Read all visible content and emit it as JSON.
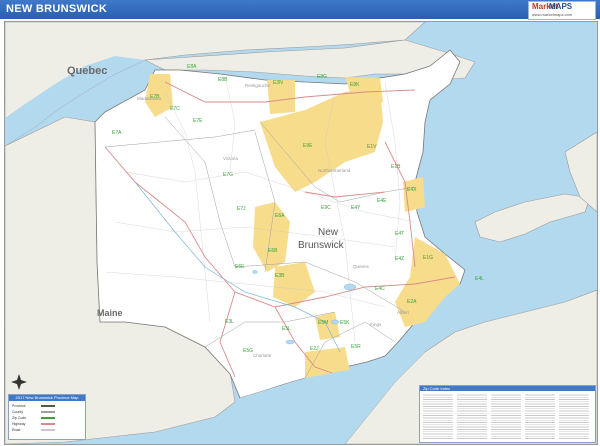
{
  "page": {
    "title": "NEW BRUNSWICK"
  },
  "logo": {
    "part1": "Market",
    "part2": "MAPS",
    "tagline": "www.marketmaps.com"
  },
  "colors": {
    "water": "#b3d9ef",
    "land_other": "#efeee6",
    "province": "#ffffff",
    "highlight": "#f7dc8c",
    "zip_label": "#3aa33a",
    "road_major": "#d98b8b",
    "boundary": "#8e8e8e",
    "title_bar": "#3f79c9"
  },
  "map": {
    "region_labels": {
      "quebec": "Quebec",
      "maine": "Maine",
      "nb_line1": "New",
      "nb_line2": "Brunswick"
    },
    "county_labels": [
      "Madawaska",
      "Restigouche",
      "Victoria",
      "Northumberland",
      "Queens",
      "Charlotte",
      "Albert",
      "Kings"
    ],
    "zip_labels": [
      "E8A",
      "E8B",
      "E3N",
      "E8G",
      "E8K",
      "E7B",
      "E7C",
      "E7E",
      "E7A",
      "E9E",
      "E1V",
      "E1B",
      "E4X",
      "E7G",
      "E9C",
      "E4Y",
      "E4E",
      "E7J",
      "E6A",
      "E6B",
      "E4T",
      "E4C",
      "E4Z",
      "E1G",
      "E6E",
      "E3B",
      "E4L",
      "E5L",
      "E2A",
      "E2J",
      "E5M",
      "E5K",
      "E5R",
      "E3L",
      "E5G"
    ]
  },
  "legend": {
    "title": "2017 New Brunswick Province Map",
    "rows": [
      "Province",
      "County",
      "Zip Code",
      "Highway",
      "Road"
    ]
  },
  "index": {
    "title": "Zip Code Index"
  }
}
